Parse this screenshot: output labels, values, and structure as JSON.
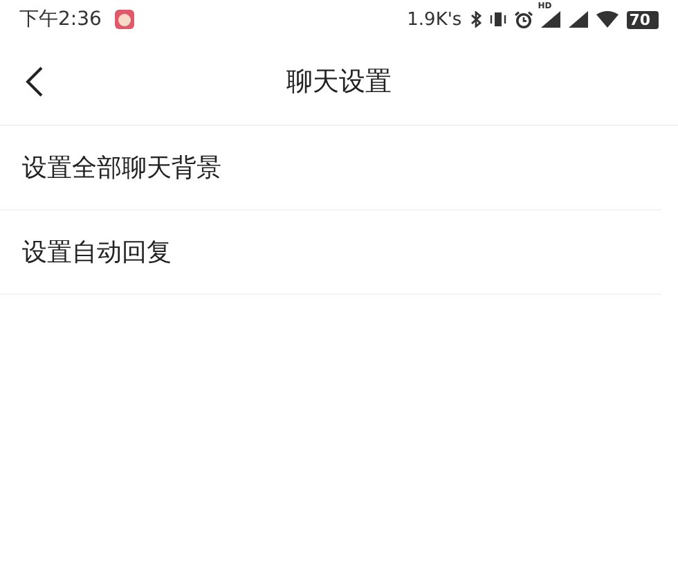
{
  "status_bar": {
    "time": "下午2:36",
    "net_speed": "1.9K's",
    "hd_label": "HD",
    "battery": "70"
  },
  "header": {
    "title": "聊天设置"
  },
  "items": [
    {
      "label": "设置全部聊天背景"
    },
    {
      "label": "设置自动回复"
    }
  ]
}
